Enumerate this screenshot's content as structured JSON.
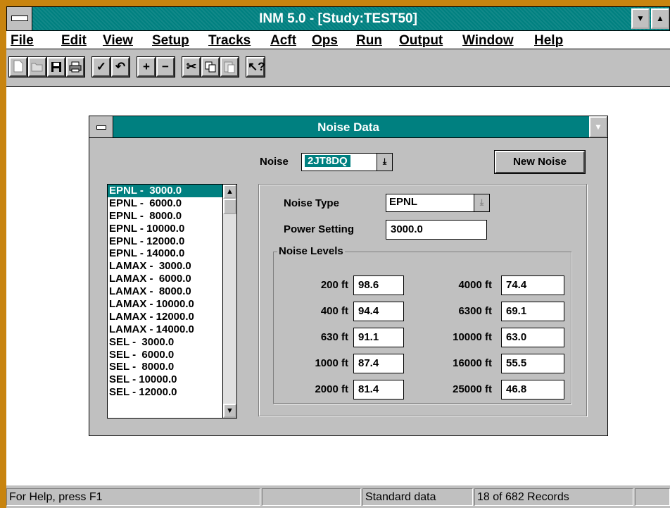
{
  "app": {
    "title": "INM 5.0 - [Study:TEST50]"
  },
  "menu": [
    "File",
    "Edit",
    "View",
    "Setup",
    "Tracks",
    "Acft",
    "Ops",
    "Run",
    "Output",
    "Window",
    "Help"
  ],
  "toolbar_icons": [
    "new-icon",
    "open-icon",
    "save-icon",
    "print-icon",
    "check-icon",
    "undo-icon",
    "add-icon",
    "remove-icon",
    "cut-icon",
    "copy-icon",
    "paste-icon",
    "help-pointer-icon"
  ],
  "dialog": {
    "title": "Noise Data",
    "noise_label": "Noise",
    "noise_value": "2JT8DQ",
    "new_noise_button": "New Noise",
    "list_items": [
      "EPNL -  3000.0",
      "EPNL -  6000.0",
      "EPNL -  8000.0",
      "EPNL - 10000.0",
      "EPNL - 12000.0",
      "EPNL - 14000.0",
      "LAMAX -  3000.0",
      "LAMAX -  6000.0",
      "LAMAX -  8000.0",
      "LAMAX - 10000.0",
      "LAMAX - 12000.0",
      "LAMAX - 14000.0",
      "SEL -  3000.0",
      "SEL -  6000.0",
      "SEL -  8000.0",
      "SEL - 10000.0",
      "SEL - 12000.0"
    ],
    "selected_index": 0,
    "noise_type_label": "Noise Type",
    "noise_type_value": "EPNL",
    "power_setting_label": "Power Setting",
    "power_setting_value": "3000.0",
    "noise_levels_title": "Noise Levels",
    "levels_left": [
      {
        "dist": "200 ft",
        "value": "98.6"
      },
      {
        "dist": "400 ft",
        "value": "94.4"
      },
      {
        "dist": "630 ft",
        "value": "91.1"
      },
      {
        "dist": "1000 ft",
        "value": "87.4"
      },
      {
        "dist": "2000 ft",
        "value": "81.4"
      }
    ],
    "levels_right": [
      {
        "dist": "4000 ft",
        "value": "74.4"
      },
      {
        "dist": "6300 ft",
        "value": "69.1"
      },
      {
        "dist": "10000 ft",
        "value": "63.0"
      },
      {
        "dist": "16000 ft",
        "value": "55.5"
      },
      {
        "dist": "25000 ft",
        "value": "46.8"
      }
    ]
  },
  "status": {
    "help": "For Help, press F1",
    "mode": "Standard data",
    "records": "18 of 682  Records"
  },
  "colors": {
    "titlebar": "#008080",
    "frame": "#c8840f",
    "face": "#c0c0c0"
  }
}
